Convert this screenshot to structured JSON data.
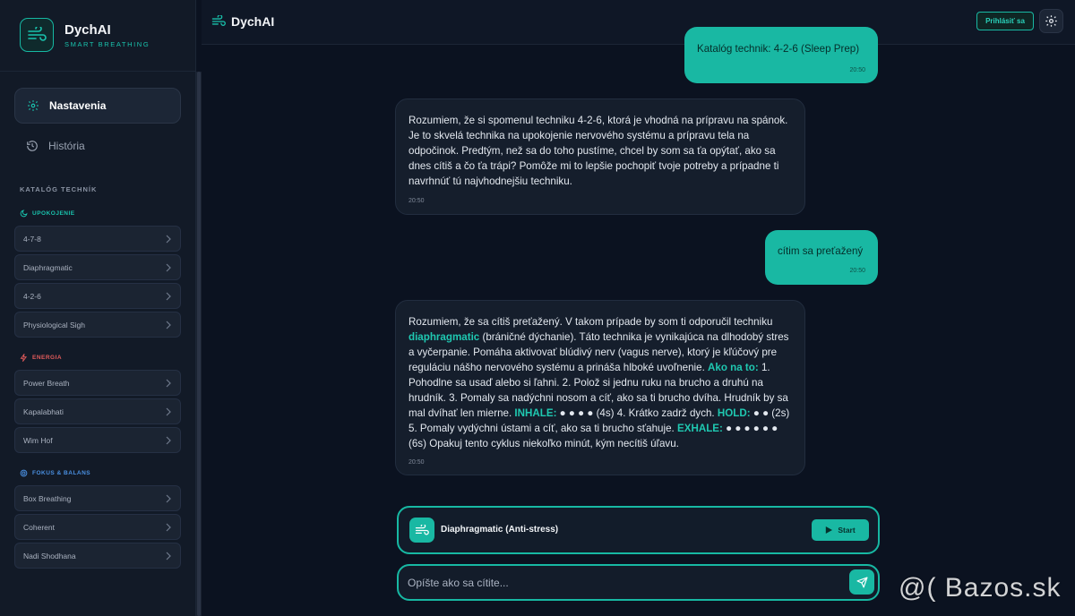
{
  "brand": {
    "name": "DychAI",
    "tagline": "SMART BREATHING"
  },
  "nav": {
    "settings": "Nastavenia",
    "history": "História"
  },
  "catalog": {
    "heading": "KATALÓG TECHNÍK",
    "groups": [
      {
        "label": "UPOKOJENIE",
        "color": "#19c3ad",
        "items": [
          "4-7-8",
          "Diaphragmatic",
          "4-2-6",
          "Physiological Sigh"
        ]
      },
      {
        "label": "ENERGIA",
        "color": "#e25b5b",
        "items": [
          "Power Breath",
          "Kapalabhati",
          "Wim Hof"
        ]
      },
      {
        "label": "FOKUS & BALANS",
        "color": "#4a90e2",
        "items": [
          "Box Breathing",
          "Coherent",
          "Nadi Shodhana"
        ]
      }
    ]
  },
  "header": {
    "title": "DychAI",
    "login": "Prihlásiť sa"
  },
  "chat": {
    "messages": [
      {
        "role": "user",
        "text": "Katalóg technik: 4-2-6 (Sleep Prep)",
        "time": "20:50"
      },
      {
        "role": "bot",
        "text": "Rozumiem, že si spomenul techniku 4-2-6, ktorá je vhodná na prípravu na spánok. Je to skvelá technika na upokojenie nervového systému a prípravu tela na odpočinok. Predtým, než sa do toho pustíme, chcel by som sa ťa opýtať, ako sa dnes cítiš a čo ťa trápi? Pomôže mi to lepšie pochopiť tvoje potreby a prípadne ti navrhnúť tú najvhodnejšiu techniku.",
        "time": "20:50"
      },
      {
        "role": "user",
        "text": "cítim sa preťažený",
        "time": "20:50"
      },
      {
        "role": "bot",
        "time": "20:50",
        "p1": "Rozumiem, že sa cítiš preťažený. V takom prípade by som ti odporučil techniku",
        "hl1": "diaphragmatic",
        "p2": "(bráničné dýchanie). Táto technika je vynikajúca na dlhodobý stres a vyčerpanie. Pomáha aktivovať blúdivý nerv (vagus nerve), ktorý je kľúčový pre reguláciu nášho nervového systému a prináša hlboké uvoľnenie.",
        "hl2": "Ako na to:",
        "p3": "1. Pohodlne sa usaď alebo si ľahni. 2. Polož si jednu ruku na brucho a druhú na hrudník. 3. Pomaly sa nadýchni nosom a cíť, ako sa ti brucho dvíha. Hrudník by sa mal dvíhať len mierne.",
        "hl3": "INHALE:",
        "p4": "● ● ● ● (4s) 4. Krátko zadrž dych.",
        "hl4": "HOLD:",
        "p5": "● ● (2s) 5. Pomaly vydýchni ústami a cíť, ako sa ti brucho sťahuje.",
        "hl5": "EXHALE:",
        "p6": "● ● ● ● ● ● (6s) Opakuj tento cyklus niekoľko minút, kým necítiš úľavu."
      }
    ]
  },
  "start_card": {
    "title": "Diaphragmatic (Anti-stress)",
    "button": "Start"
  },
  "input": {
    "placeholder": "Opíšte ako sa cítite..."
  },
  "watermark": "@( Bazos.sk",
  "colors": {
    "accent": "#19b8a3",
    "background": "#0b1220",
    "sidebar": "#121a27"
  }
}
